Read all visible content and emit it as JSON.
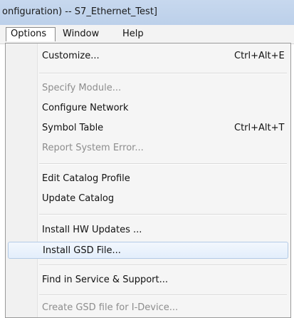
{
  "window": {
    "title": "onfiguration) -- S7_Ethernet_Test]"
  },
  "menubar": {
    "items": [
      {
        "label": "Options",
        "active": true
      },
      {
        "label": "Window",
        "active": false
      },
      {
        "label": "Help",
        "active": false
      }
    ]
  },
  "menu": {
    "items": [
      {
        "label": "Customize...",
        "shortcut": "Ctrl+Alt+E",
        "enabled": true
      },
      {
        "label": "Specify Module...",
        "shortcut": "",
        "enabled": false
      },
      {
        "label": "Configure Network",
        "shortcut": "",
        "enabled": true
      },
      {
        "label": "Symbol Table",
        "shortcut": "Ctrl+Alt+T",
        "enabled": true
      },
      {
        "label": "Report System Error...",
        "shortcut": "",
        "enabled": false
      },
      {
        "label": "Edit Catalog Profile",
        "shortcut": "",
        "enabled": true
      },
      {
        "label": "Update Catalog",
        "shortcut": "",
        "enabled": true
      },
      {
        "label": "Install HW Updates ...",
        "shortcut": "",
        "enabled": true
      },
      {
        "label": "Install GSD File...",
        "shortcut": "",
        "enabled": true,
        "highlighted": true
      },
      {
        "label": "Find in Service & Support...",
        "shortcut": "",
        "enabled": true
      },
      {
        "label": "Create GSD file for I-Device...",
        "shortcut": "",
        "enabled": false
      }
    ]
  }
}
